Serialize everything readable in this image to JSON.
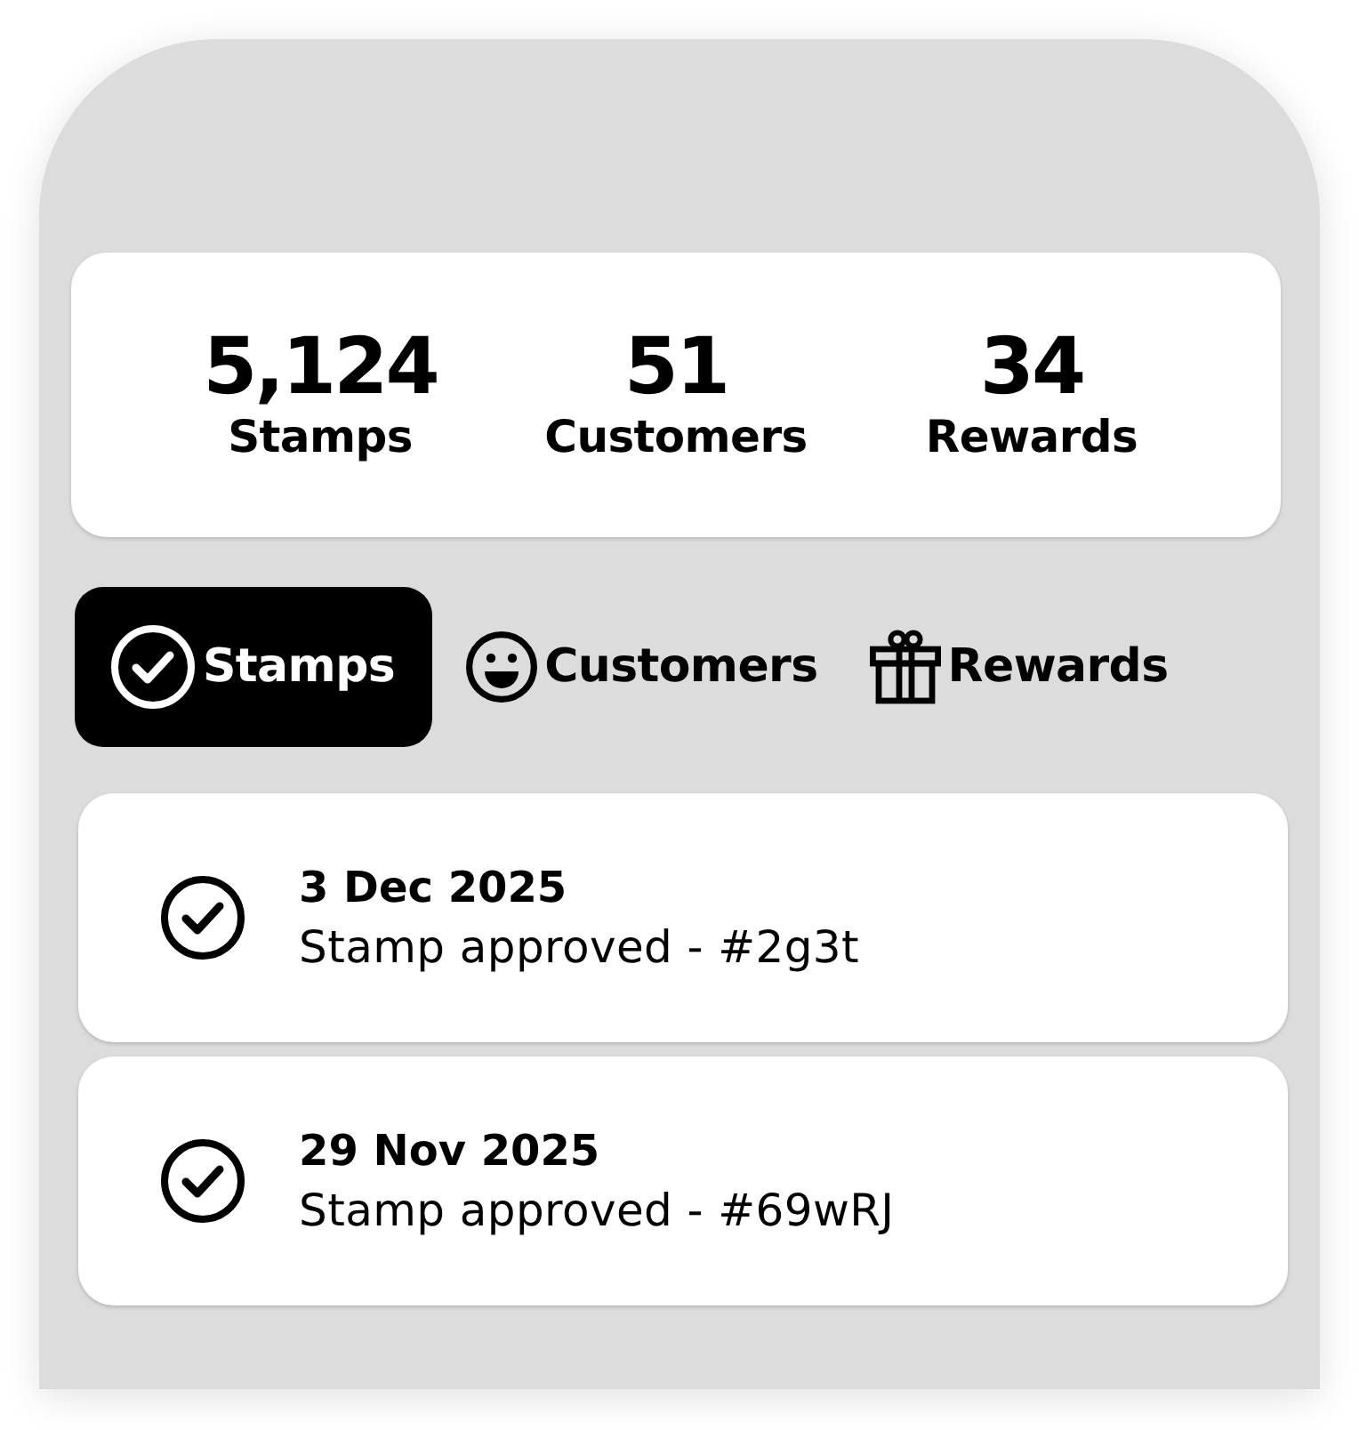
{
  "stats": [
    {
      "value": "5,124",
      "label": "Stamps"
    },
    {
      "value": "51",
      "label": "Customers"
    },
    {
      "value": "34",
      "label": "Rewards"
    }
  ],
  "tabs": [
    {
      "label": "Stamps",
      "kind": "check",
      "selected": true
    },
    {
      "label": "Customers",
      "kind": "smiley",
      "selected": false
    },
    {
      "label": "Rewards",
      "kind": "gift",
      "selected": false
    }
  ],
  "activity": [
    {
      "date": "3 Dec 2025",
      "description": "Stamp approved - #2g3t"
    },
    {
      "date": "29 Nov 2025",
      "description": "Stamp approved - #69wRJ"
    }
  ]
}
